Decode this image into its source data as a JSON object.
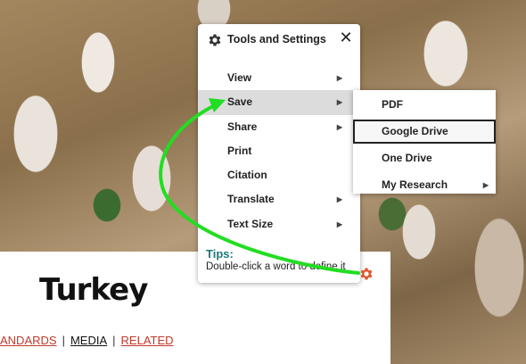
{
  "page": {
    "title": "Turkey",
    "nav": [
      {
        "label": "ANDARDS"
      },
      {
        "label": "MEDIA"
      },
      {
        "label": "RELATED"
      }
    ],
    "separator": "|"
  },
  "tools_panel": {
    "title": "Tools and Settings",
    "close_icon": "close-icon",
    "menu_items": [
      {
        "label": "View",
        "has_submenu": true
      },
      {
        "label": "Save",
        "has_submenu": true
      },
      {
        "label": "Share",
        "has_submenu": true
      },
      {
        "label": "Print",
        "has_submenu": false
      },
      {
        "label": "Citation",
        "has_submenu": false
      },
      {
        "label": "Translate",
        "has_submenu": true
      },
      {
        "label": "Text Size",
        "has_submenu": true
      }
    ],
    "tips_label": "Tips:",
    "tips_text": "Double-click a word to define it"
  },
  "save_submenu": {
    "items": [
      {
        "label": "PDF"
      },
      {
        "label": "Google Drive"
      },
      {
        "label": "One Drive"
      },
      {
        "label": "My Research"
      }
    ]
  },
  "colors": {
    "accent_red": "#c0392b",
    "annotation_green": "#22dd22",
    "tips_teal": "#1b7a7a",
    "gear_orange": "#e2552a"
  }
}
